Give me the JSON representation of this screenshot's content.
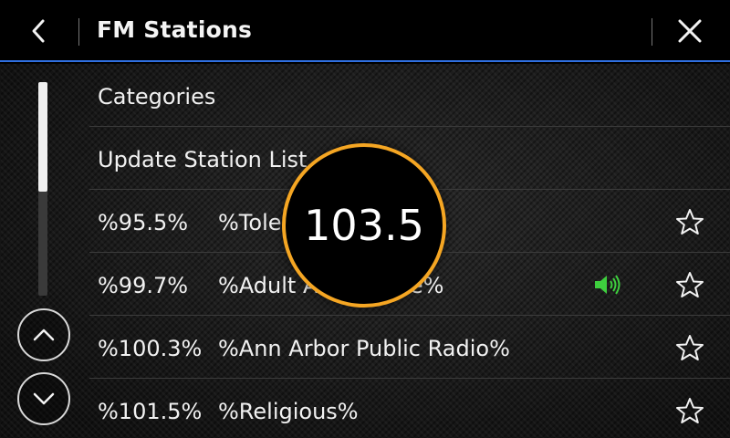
{
  "header": {
    "title": "FM Stations"
  },
  "menu": {
    "categories": "Categories",
    "update": "Update Station List"
  },
  "stations": [
    {
      "freq": "%95.5%",
      "name": "%Toledo%",
      "playing": false
    },
    {
      "freq": "%99.7%",
      "name": "%Adult Alternative%",
      "playing": true
    },
    {
      "freq": "%100.3%",
      "name": "%Ann Arbor Public Radio%",
      "playing": false
    },
    {
      "freq": "%101.5%",
      "name": "%Religious%",
      "playing": false
    }
  ],
  "overlay": {
    "frequency": "103.5"
  },
  "icons": {
    "back": "chevron-left-icon",
    "close": "close-icon",
    "scroll_up": "chevron-up-icon",
    "scroll_down": "chevron-down-icon",
    "favorite": "star-outline-icon",
    "now_playing": "speaker-icon"
  },
  "colors": {
    "accent_line": "#2f6fe0",
    "overlay_ring": "#f5a623",
    "now_playing": "#3ecf3e"
  },
  "scroll": {
    "position_fraction": 0
  }
}
